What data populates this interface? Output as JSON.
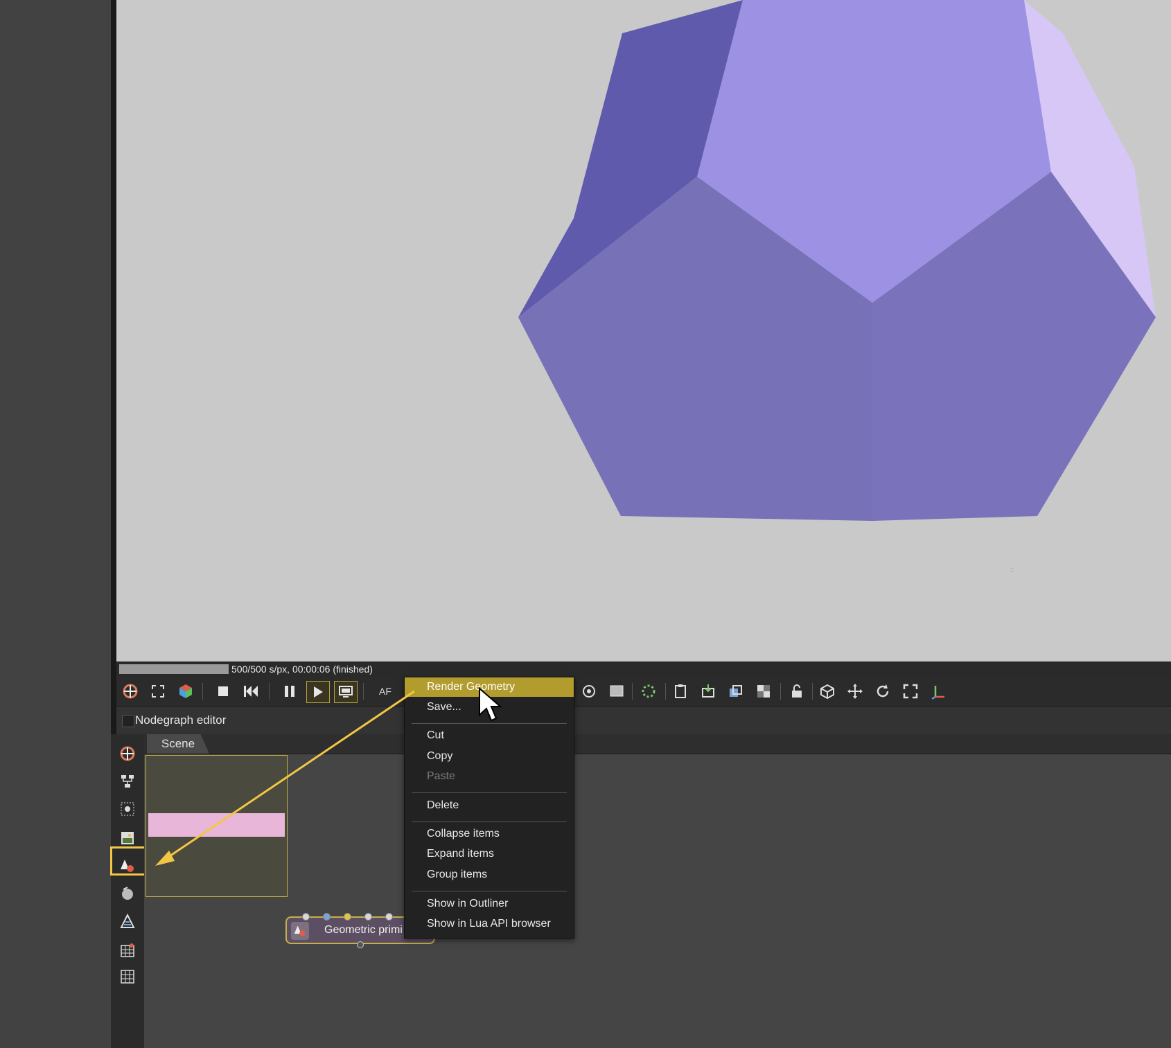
{
  "status": {
    "progress_fraction": 1.0,
    "text": "500/500 s/px, 00:00:06 (finished)"
  },
  "toolbar": {
    "icons": [
      "render-target-icon",
      "region-icon",
      "cube-icon",
      "stop-icon",
      "rewind-icon",
      "pause-icon",
      "play-icon",
      "display-icon",
      "af-icon"
    ],
    "af_label": "AF"
  },
  "nodegraph": {
    "title": "Nodegraph editor",
    "tab": "Scene",
    "node_label": "Geometric primi"
  },
  "context_menu": {
    "items": [
      {
        "label": "Render Geometry",
        "highlighted": true
      },
      {
        "label": "Save..."
      },
      {
        "label": "Cut"
      },
      {
        "label": "Copy"
      },
      {
        "label": "Paste",
        "disabled": true
      },
      {
        "label": "Delete"
      },
      {
        "label": "Collapse items"
      },
      {
        "label": "Expand items"
      },
      {
        "label": "Group items"
      },
      {
        "label": "Show in Outliner"
      },
      {
        "label": "Show in Lua API browser"
      }
    ]
  },
  "colors": {
    "accent": "#f2c744",
    "highlight": "#b39c2e",
    "viewport_bg": "#c9c9c9",
    "shape_main": "#7a73bb",
    "shape_light": "#9c91e3"
  }
}
